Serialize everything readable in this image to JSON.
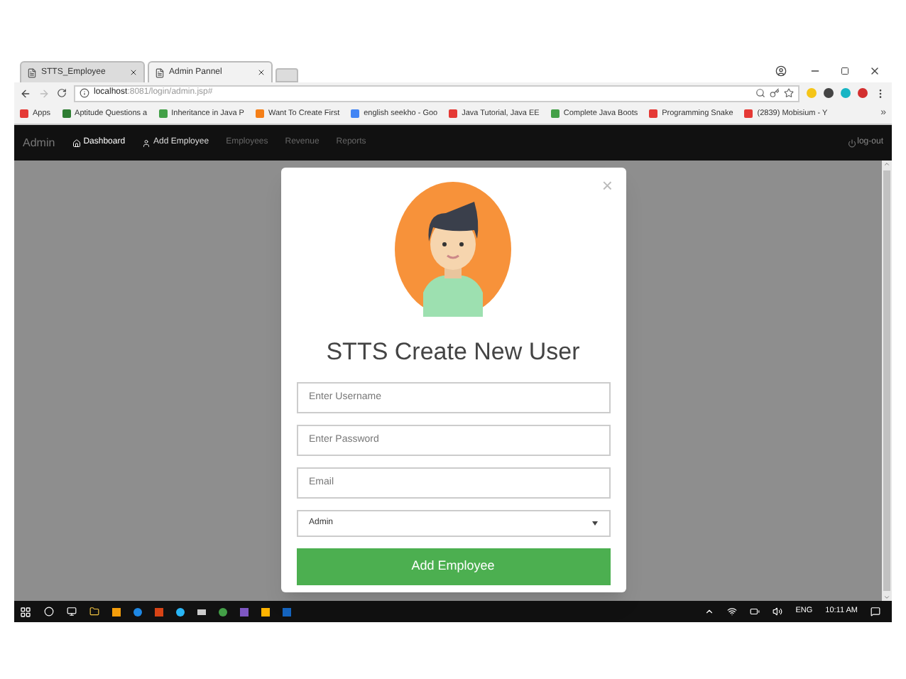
{
  "browser": {
    "tabs": [
      {
        "label": "STTS_Employee",
        "selected": false
      },
      {
        "label": "Admin Pannel",
        "selected": true
      }
    ],
    "address": {
      "host": "localhost",
      "path": ":8081/login/admin.jsp#"
    },
    "bookmarks": [
      {
        "label": "Apps",
        "color": "#e53935"
      },
      {
        "label": "Aptitude Questions a",
        "color": "#2e7d32"
      },
      {
        "label": "Inheritance in Java P",
        "color": "#43a047"
      },
      {
        "label": "Want To Create First",
        "color": "#f57f17"
      },
      {
        "label": "english seekho - Goo",
        "color": "#4285f4"
      },
      {
        "label": "Java Tutorial, Java EE",
        "color": "#e53935"
      },
      {
        "label": "Complete Java Boots",
        "color": "#43a047"
      },
      {
        "label": "Programming Snake",
        "color": "#e53935"
      },
      {
        "label": "(2839) Mobisium - Y",
        "color": "#e53935"
      }
    ],
    "more": "»"
  },
  "navbar": {
    "brand": "Admin",
    "items": [
      {
        "label": "Dashboard",
        "selected": true,
        "kind": "home"
      },
      {
        "label": "Add Employee",
        "selected": false,
        "kind": "person"
      },
      {
        "label": "Employees",
        "selected": false,
        "kind": "plain"
      },
      {
        "label": "Revenue",
        "selected": false,
        "kind": "plain"
      },
      {
        "label": "Reports",
        "selected": false,
        "kind": "plain"
      }
    ],
    "logout": "log-out"
  },
  "modal": {
    "close": "×",
    "title": "STTS Create New User",
    "fields": [
      {
        "placeholder": "Enter Username"
      },
      {
        "placeholder": "Enter Password"
      },
      {
        "placeholder": "Email"
      }
    ],
    "role": {
      "value": "Admin"
    },
    "submit": "Add Employee"
  },
  "taskbar": {
    "language": "ENG",
    "time": "10:11 AM"
  }
}
